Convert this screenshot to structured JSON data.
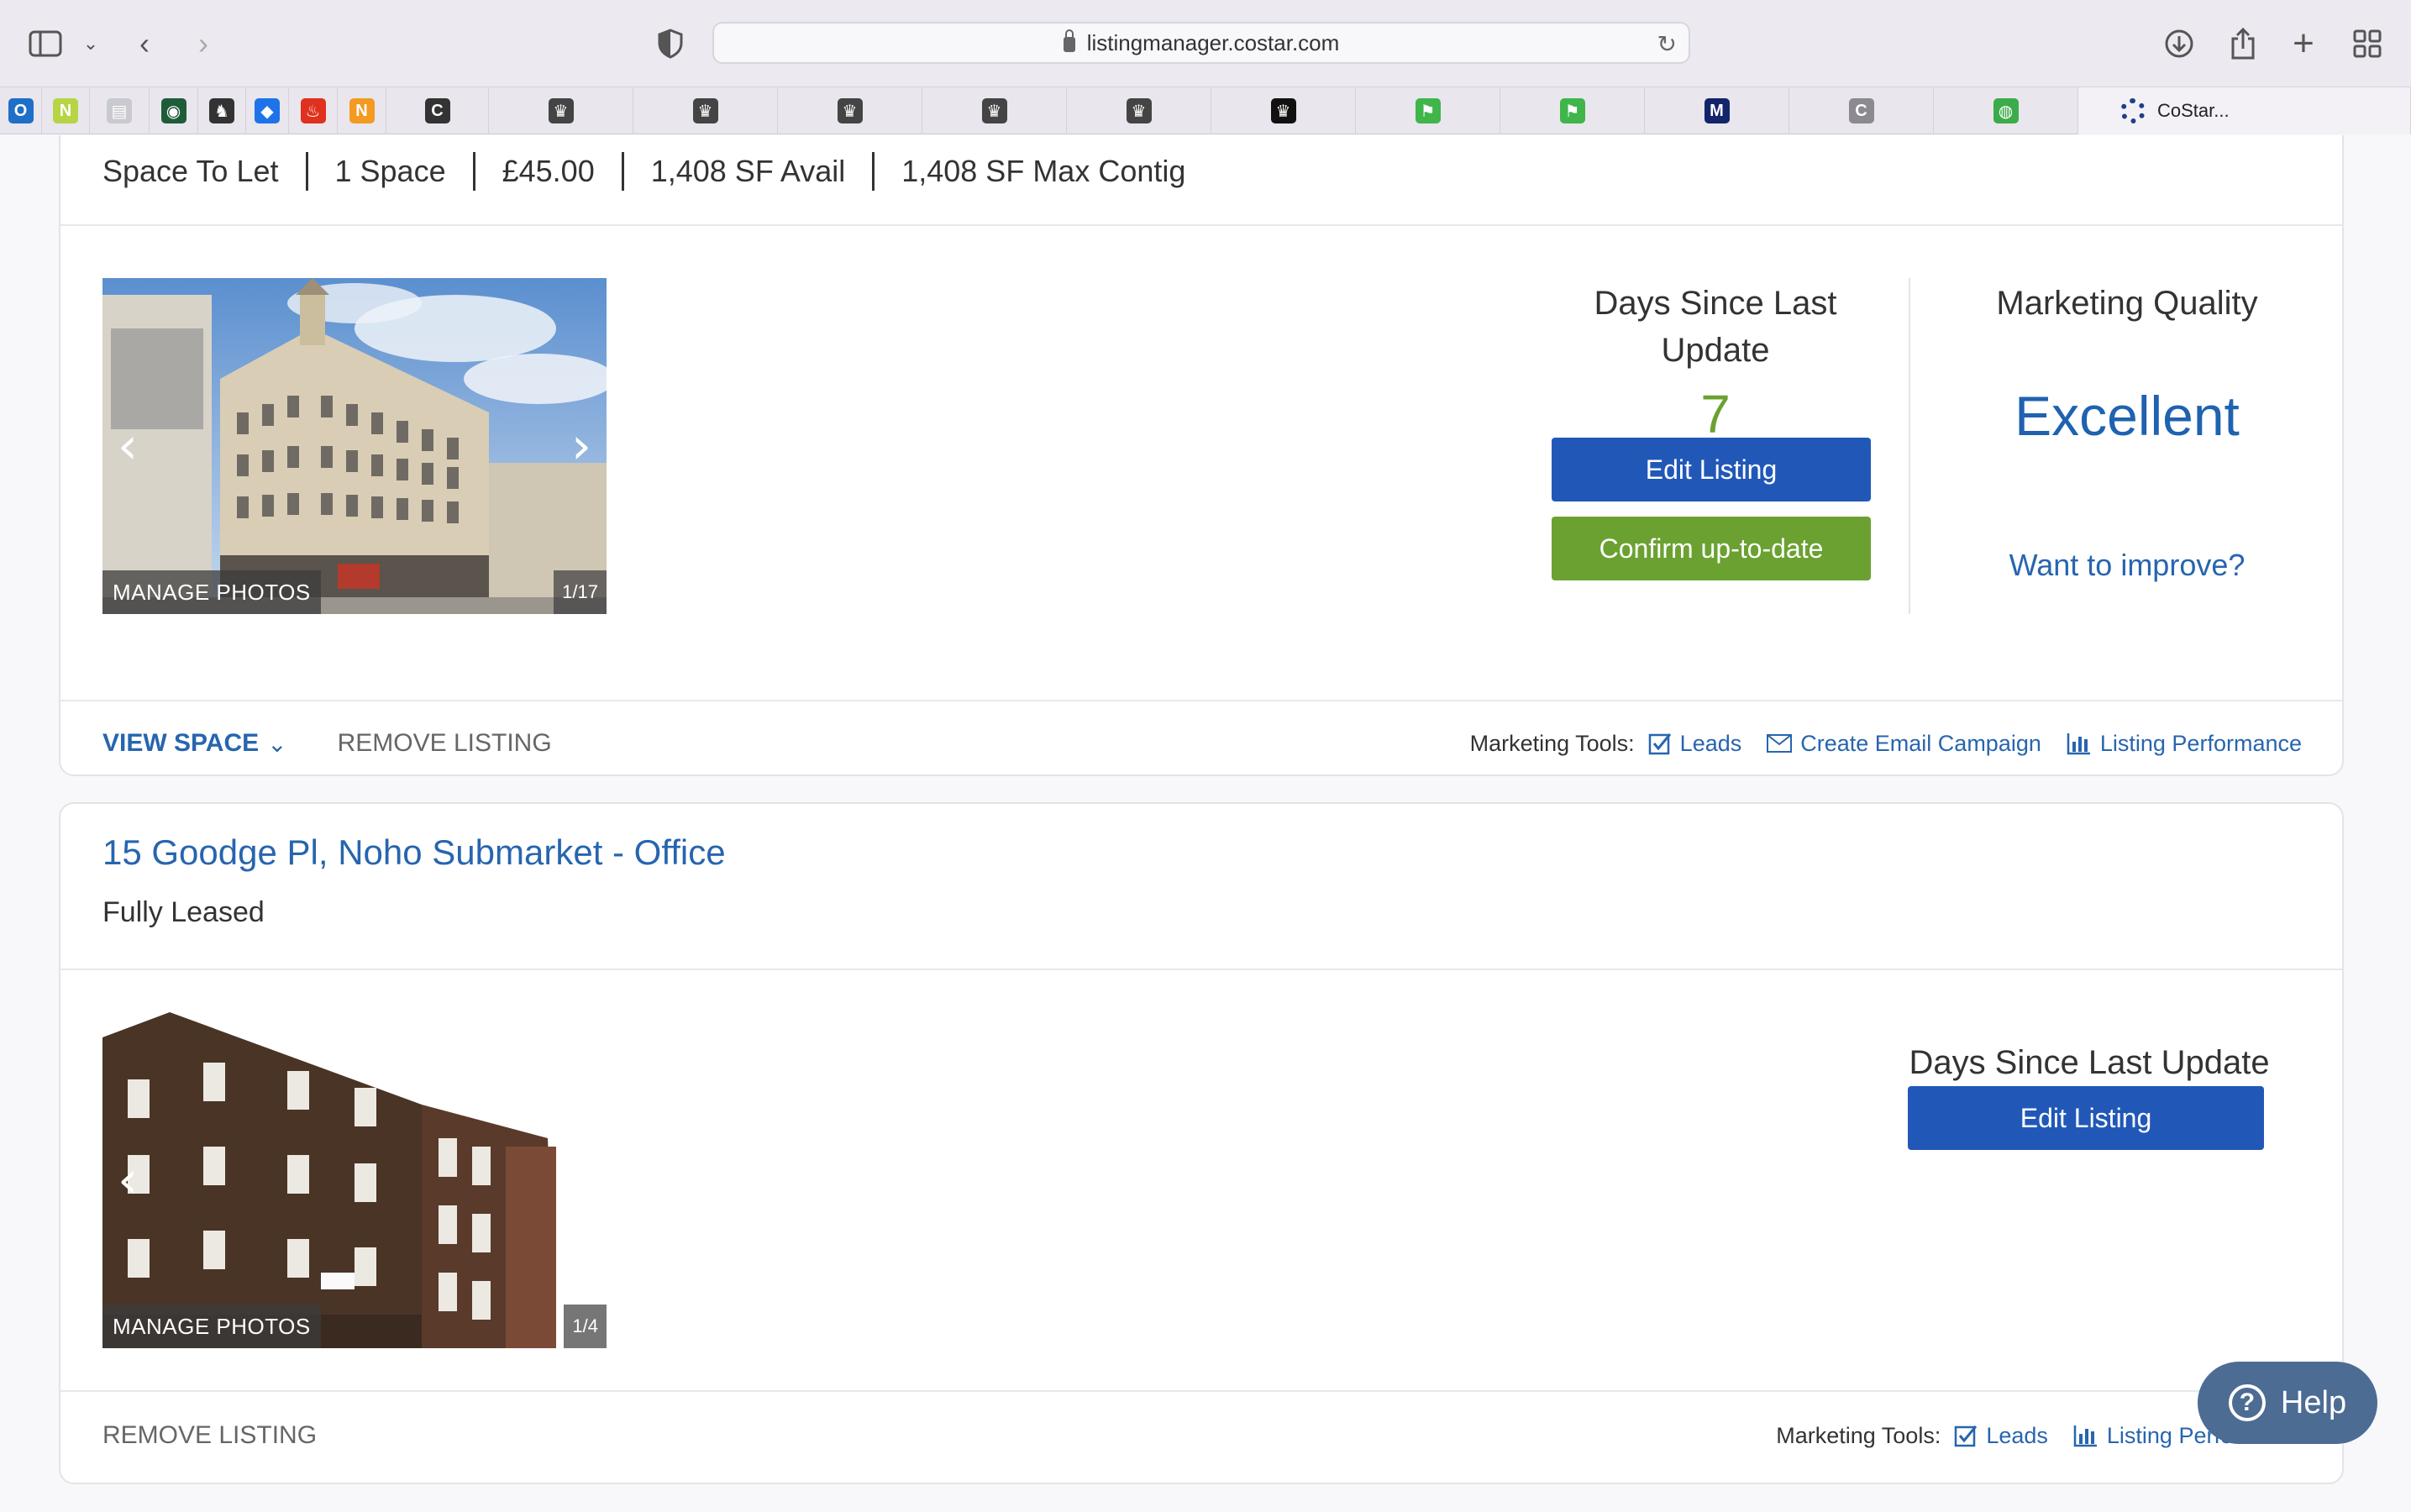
{
  "browser": {
    "url": "listingmanager.costar.com",
    "bookmarks": [
      {
        "icon": "outlook-icon",
        "color": "#1e6fc8",
        "glyph": "O"
      },
      {
        "icon": "n-green-icon",
        "color": "#b6d443",
        "glyph": "N"
      },
      {
        "icon": "document-icon",
        "color": "#c9c9d0",
        "glyph": "▤"
      },
      {
        "icon": "globe-icon",
        "color": "#1f5c3a",
        "glyph": "◉"
      },
      {
        "icon": "horse-icon",
        "color": "#333",
        "glyph": "♞"
      },
      {
        "icon": "dropbox-icon",
        "color": "#1f73e8",
        "glyph": "◆"
      },
      {
        "icon": "santander-icon",
        "color": "#e0301e",
        "glyph": "♨"
      },
      {
        "icon": "n-orange-icon",
        "color": "#f39b21",
        "glyph": "N"
      },
      {
        "icon": "c-icon",
        "color": "#333",
        "glyph": "C"
      },
      {
        "icon": "crown-icon",
        "color": "#444",
        "glyph": "♛"
      },
      {
        "icon": "crown-icon",
        "color": "#444",
        "glyph": "♛"
      },
      {
        "icon": "crown-icon",
        "color": "#444",
        "glyph": "♛"
      },
      {
        "icon": "crown-icon",
        "color": "#444",
        "glyph": "♛"
      },
      {
        "icon": "crown-icon",
        "color": "#444",
        "glyph": "♛"
      },
      {
        "icon": "crown-black-icon",
        "color": "#111",
        "glyph": "♛"
      },
      {
        "icon": "green-flag-icon",
        "color": "#3fb54a",
        "glyph": "⚑"
      },
      {
        "icon": "green-flag-icon",
        "color": "#3fb54a",
        "glyph": "⚑"
      },
      {
        "icon": "m-icon",
        "color": "#12246a",
        "glyph": "M"
      },
      {
        "icon": "c-grey-icon",
        "color": "#8a8a90",
        "glyph": "C"
      },
      {
        "icon": "green-chart-icon",
        "color": "#3cab4a",
        "glyph": "◍"
      }
    ],
    "last_tab": "CoStar..."
  },
  "listing1": {
    "summary": [
      "Space To Let",
      "1 Space",
      "£45.00",
      "1,408 SF Avail",
      "1,408 SF Max Contig"
    ],
    "manage_photos": "MANAGE PHOTOS",
    "photo_count": "1/17",
    "days_label": "Days Since Last Update",
    "days_value": "7",
    "edit_label": "Edit Listing",
    "confirm_label": "Confirm up-to-date",
    "quality_label": "Marketing Quality",
    "quality_value": "Excellent",
    "improve_link": "Want to improve?",
    "view_space": "VIEW SPACE",
    "remove": "REMOVE LISTING",
    "tools_label": "Marketing Tools:",
    "tool_leads": "Leads",
    "tool_email": "Create Email Campaign",
    "tool_performance": "Listing Performance"
  },
  "listing2": {
    "title": "15 Goodge Pl, Noho Submarket - Office",
    "status": "Fully Leased",
    "manage_photos": "MANAGE PHOTOS",
    "photo_count": "1/4",
    "days_label": "Days Since Last Update",
    "edit_label": "Edit Listing",
    "remove": "REMOVE LISTING",
    "tools_label": "Marketing Tools:",
    "tool_leads": "Leads",
    "tool_performance": "Listing Perfo"
  },
  "help": {
    "label": "Help"
  }
}
